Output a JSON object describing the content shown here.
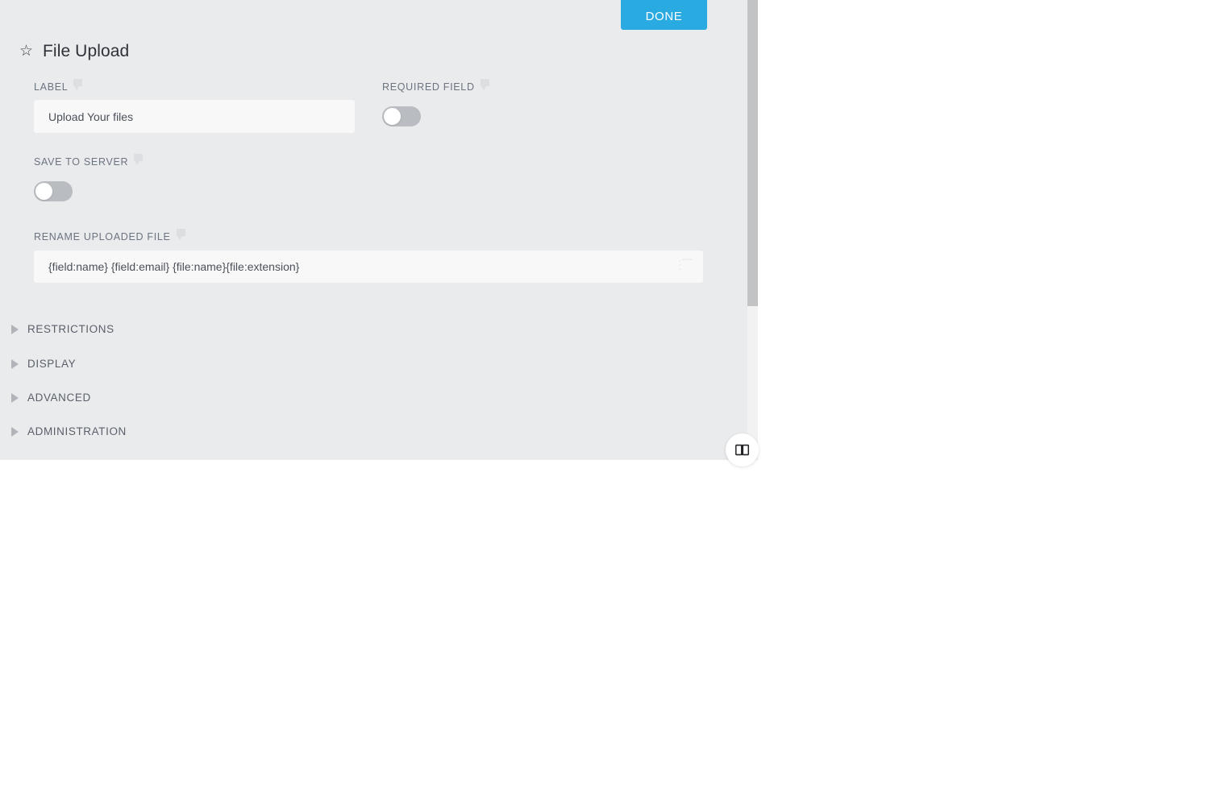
{
  "panel": {
    "title": "File Upload",
    "star_icon": "star-outline-icon",
    "done_label": "DONE"
  },
  "fields": {
    "label": {
      "label": "LABEL",
      "value": "Upload Your files",
      "placeholder": "",
      "tooltip_icon": "tooltip-bubble-icon"
    },
    "required_field": {
      "label": "REQUIRED FIELD",
      "state": "off",
      "tooltip_icon": "tooltip-bubble-icon"
    },
    "save_to_server": {
      "label": "SAVE TO SERVER",
      "state": "off",
      "tooltip_icon": "tooltip-bubble-icon"
    },
    "rename_uploaded_file": {
      "label": "RENAME UPLOADED FILE",
      "value": "{field:name} {field:email} {file:name}{file:extension}",
      "placeholder": "",
      "tooltip_icon": "tooltip-bubble-icon",
      "picker_icon": "list-icon"
    }
  },
  "sections": [
    {
      "label": "RESTRICTIONS",
      "expanded": false,
      "icon": "triangle-right-icon"
    },
    {
      "label": "DISPLAY",
      "expanded": false,
      "icon": "triangle-right-icon"
    },
    {
      "label": "ADVANCED",
      "expanded": false,
      "icon": "triangle-right-icon"
    },
    {
      "label": "ADMINISTRATION",
      "expanded": false,
      "icon": "triangle-right-icon"
    }
  ],
  "help_button": {
    "icon": "open-book-icon"
  },
  "colors": {
    "panel_background": "#eaebed",
    "accent": "#29aae1",
    "input_background": "#f8f8f9",
    "toggle_off": "#b9bcc0",
    "label_text": "#6c7480",
    "scroll_thumb": "#c2c3c5"
  }
}
